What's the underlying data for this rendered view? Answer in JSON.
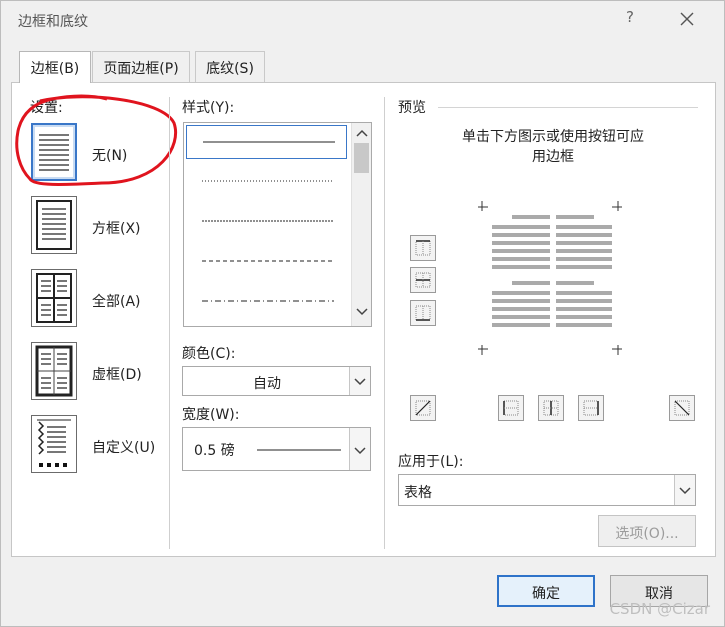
{
  "window": {
    "title": "边框和底纹",
    "help_label": "?"
  },
  "tabs": [
    {
      "label": "边框(B)",
      "active": true
    },
    {
      "label": "页面边框(P)",
      "active": false
    },
    {
      "label": "底纹(S)",
      "active": false
    }
  ],
  "settings": {
    "heading": "设置:",
    "options": [
      {
        "label": "无(N)",
        "icon": "none-border-icon",
        "selected": true
      },
      {
        "label": "方框(X)",
        "icon": "box-border-icon",
        "selected": false
      },
      {
        "label": "全部(A)",
        "icon": "all-border-icon",
        "selected": false
      },
      {
        "label": "虚框(D)",
        "icon": "grid-border-icon",
        "selected": false
      },
      {
        "label": "自定义(U)",
        "icon": "custom-border-icon",
        "selected": false
      }
    ]
  },
  "style": {
    "heading": "样式(Y):",
    "items": [
      "solid",
      "dotted",
      "fine-dotted",
      "dashed",
      "dash-dot"
    ]
  },
  "color": {
    "heading": "颜色(C):",
    "value": "自动"
  },
  "width": {
    "heading": "宽度(W):",
    "value": "0.5 磅"
  },
  "preview": {
    "heading": "预览",
    "hint_line1": "单击下方图示或使用按钮可应",
    "hint_line2": "用边框"
  },
  "apply_to": {
    "heading": "应用于(L):",
    "value": "表格"
  },
  "buttons": {
    "options": "选项(O)...",
    "ok": "确定",
    "cancel": "取消"
  },
  "watermark": "CSDN @Cizar",
  "colors": {
    "accent": "#2e73c9",
    "annotation": "#e0141e"
  }
}
